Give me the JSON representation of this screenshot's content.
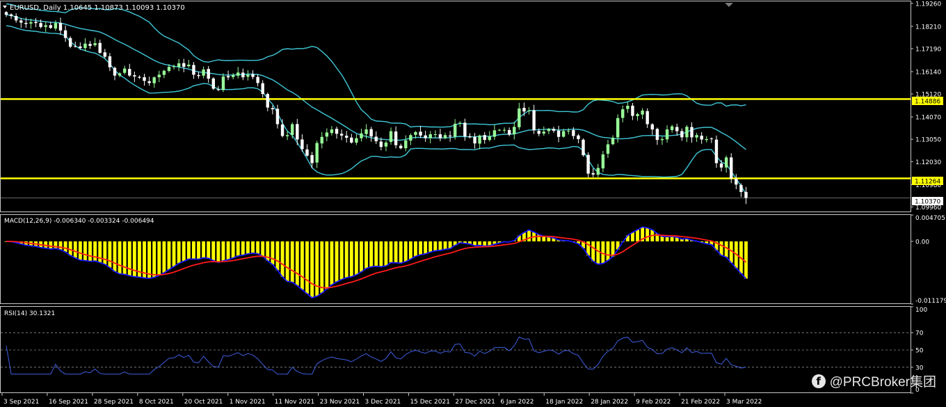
{
  "colors": {
    "background": "#000000",
    "frame": "#c8c8c8",
    "bull_candle": "#98FB98",
    "bear_candle": "#ffffff",
    "bollinger": "#40c8d8",
    "hline": "#ffff00",
    "price_label_bg": "#ffff00",
    "macd_hist": "#ffff00",
    "macd_line": "#1515ff",
    "signal_line": "#ff1a1a",
    "rsi_line": "#3f5fe0",
    "level_dash": "#8c8c8c",
    "text": "#ffffff"
  },
  "header": {
    "title": "EURUSD, Daily  1.10645 1.10873 1.10093 1.10370"
  },
  "price_panel": {
    "price_ticks": [
      "1.19260",
      "1.18210",
      "1.17190",
      "1.16140",
      "1.15120",
      "1.14070",
      "1.13050",
      "1.12030",
      "1.10980",
      "1.09960"
    ],
    "labels": {
      "upper": "1.14886",
      "lower": "1.11264",
      "last": "1.10370"
    }
  },
  "macd_panel": {
    "title": "MACD(12,26,9) -0.006340 -0.003324 -0.006494",
    "ticks": [
      "0.004705",
      "0.00",
      "-0.011179"
    ]
  },
  "rsi_panel": {
    "title": "RSI(14) 30.1321",
    "ticks": [
      "100",
      "70",
      "50",
      "30",
      "0"
    ]
  },
  "time_axis": {
    "labels": [
      "3 Sep 2021",
      "16 Sep 2021",
      "28 Sep 2021",
      "8 Oct 2021",
      "20 Oct 2021",
      "1 Nov 2021",
      "11 Nov 2021",
      "23 Nov 2021",
      "3 Dec 2021",
      "15 Dec 2021",
      "27 Dec 2021",
      "6 Jan 2022",
      "18 Jan 2022",
      "28 Jan 2022",
      "9 Feb 2022",
      "21 Feb 2022",
      "3 Mar 2022"
    ]
  },
  "watermark": {
    "icon": "facebook-icon",
    "icon_glyph": "f",
    "text": "@PRCBroker集团"
  },
  "chart_data": [
    {
      "type": "candlestick",
      "title": "EURUSD, Daily  1.10645 1.10873 1.10093 1.10370",
      "symbol": "EURUSD",
      "timeframe": "Daily",
      "last_bar": {
        "open": 1.10645,
        "high": 1.10873,
        "low": 1.10093,
        "close": 1.1037
      },
      "ylim": [
        1.0975,
        1.1935
      ],
      "y_ticks": [
        1.1926,
        1.1821,
        1.1719,
        1.1614,
        1.1512,
        1.1407,
        1.1305,
        1.1203,
        1.1098,
        1.0996
      ],
      "horizontal_lines": [
        1.14886,
        1.11264
      ],
      "last_price_line": 1.1037,
      "x_tick_labels": [
        "3 Sep 2021",
        "16 Sep 2021",
        "28 Sep 2021",
        "8 Oct 2021",
        "20 Oct 2021",
        "1 Nov 2021",
        "11 Nov 2021",
        "23 Nov 2021",
        "3 Dec 2021",
        "15 Dec 2021",
        "27 Dec 2021",
        "6 Jan 2022",
        "18 Jan 2022",
        "28 Jan 2022",
        "9 Feb 2022",
        "21 Feb 2022",
        "3 Mar 2022"
      ],
      "close": [
        1.1874,
        1.1868,
        1.1848,
        1.1838,
        1.1832,
        1.184,
        1.1836,
        1.1818,
        1.1826,
        1.1814,
        1.1836,
        1.1802,
        1.1768,
        1.1728,
        1.173,
        1.1722,
        1.1742,
        1.1732,
        1.1744,
        1.17,
        1.1682,
        1.1634,
        1.1596,
        1.1606,
        1.1628,
        1.1596,
        1.1592,
        1.1586,
        1.1572,
        1.1562,
        1.1588,
        1.16,
        1.1618,
        1.1636,
        1.1638,
        1.1652,
        1.1636,
        1.1646,
        1.16,
        1.1594,
        1.1624,
        1.1582,
        1.1536,
        1.153,
        1.1592,
        1.1588,
        1.1598,
        1.161,
        1.1588,
        1.16,
        1.159,
        1.1562,
        1.1512,
        1.145,
        1.1442,
        1.1374,
        1.132,
        1.1324,
        1.1374,
        1.1304,
        1.126,
        1.123,
        1.1196,
        1.1288,
        1.1316,
        1.1336,
        1.135,
        1.133,
        1.1322,
        1.1312,
        1.129,
        1.131,
        1.1332,
        1.135,
        1.1318,
        1.1296,
        1.127,
        1.129,
        1.1342,
        1.1278,
        1.1264,
        1.13,
        1.1324,
        1.1338,
        1.1322,
        1.131,
        1.1328,
        1.1328,
        1.131,
        1.1324,
        1.1318,
        1.1376,
        1.138,
        1.1318,
        1.1314,
        1.1286,
        1.1322,
        1.1302,
        1.1318,
        1.1346,
        1.1348,
        1.1348,
        1.1326,
        1.1362,
        1.1446,
        1.1432,
        1.1436,
        1.1346,
        1.133,
        1.134,
        1.1352,
        1.1344,
        1.1316,
        1.1342,
        1.1344,
        1.132,
        1.1306,
        1.1232,
        1.1148,
        1.1144,
        1.1174,
        1.1236,
        1.1282,
        1.1312,
        1.1402,
        1.1442,
        1.1458,
        1.1412,
        1.142,
        1.1436,
        1.1374,
        1.135,
        1.1302,
        1.1306,
        1.135,
        1.1364,
        1.1342,
        1.1314,
        1.1362,
        1.1314,
        1.1324,
        1.1304,
        1.1306,
        1.1306,
        1.1196,
        1.1176,
        1.1222,
        1.1126,
        1.1098,
        1.1064,
        1.1037
      ]
    },
    {
      "type": "line",
      "title": "MACD(12,26,9) -0.006340 -0.003324 -0.006494",
      "ylim": [
        -0.011179,
        0.004705
      ],
      "y_ticks": [
        0.004705,
        0.0,
        -0.011179
      ],
      "last_values": {
        "macd": -0.00634,
        "signal": -0.003324,
        "osma": -0.006494
      },
      "series_note": "histogram + fast line (blue) + signal line (red) derived from the close series"
    },
    {
      "type": "line",
      "title": "RSI(14) 30.1321",
      "ylim": [
        0,
        100
      ],
      "levels": [
        70,
        50,
        30
      ],
      "y_ticks": [
        100,
        70,
        50,
        30,
        0
      ],
      "last_value": 30.1321
    }
  ]
}
